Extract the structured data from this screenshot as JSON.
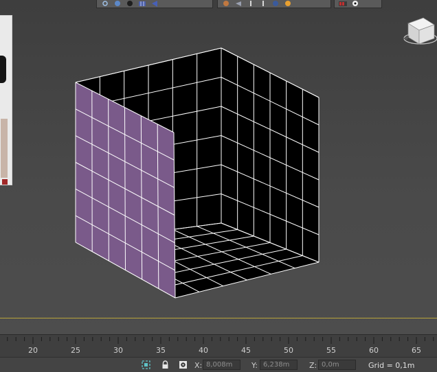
{
  "viewport": {
    "background_color": "#444444",
    "object": {
      "type": "box",
      "segments": 6,
      "left_face_color": "#7a5a8a",
      "wire_color": "#ffffff",
      "interior_color": "#000000"
    },
    "timeline_rule_color": "#b8a43a"
  },
  "toolbar": {
    "groups": [
      {
        "icons": [
          "rotate-icon",
          "sphere-icon",
          "dark-sphere-icon",
          "grid-icon",
          "cone-icon"
        ]
      },
      {
        "icons": [
          "teapot-icon",
          "light-icon",
          "camera-icon",
          "pin-icon",
          "globe-icon",
          "fire-icon"
        ]
      },
      {
        "icons": [
          "render-icon",
          "soccer-ball-icon"
        ]
      }
    ]
  },
  "timeline": {
    "labels": [
      "20",
      "25",
      "30",
      "35",
      "40",
      "45",
      "50",
      "55",
      "60",
      "65"
    ]
  },
  "statusbar": {
    "x_label": "X:",
    "x_value": "8,008m",
    "y_label": "Y:",
    "y_value": "6,238m",
    "z_label": "Z:",
    "z_value": "0,0m",
    "grid_text": "Grid = 0,1m"
  }
}
